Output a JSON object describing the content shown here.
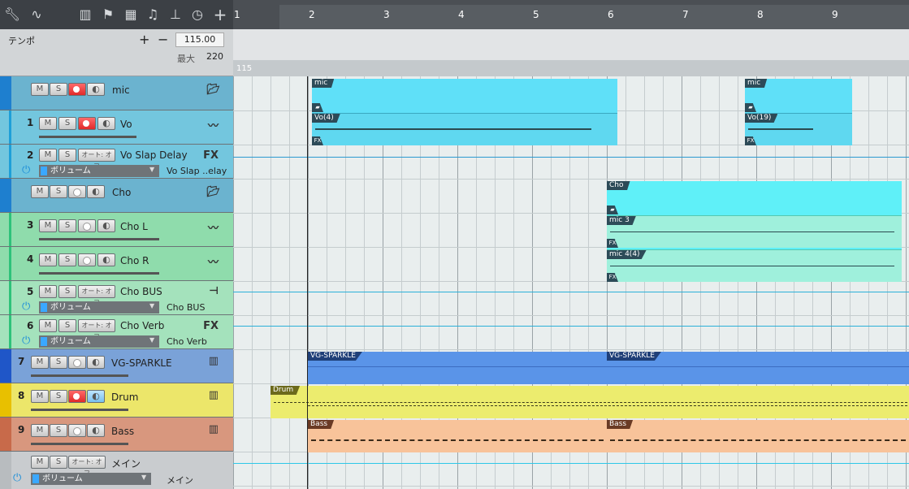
{
  "toolbar": {
    "icons": [
      "wrench-icon",
      "curve-icon",
      "mixer-icon",
      "flag-icon",
      "grid-icon",
      "note-icon",
      "split-icon",
      "clock-icon",
      "plus-icon"
    ]
  },
  "tempo": {
    "label": "テンポ",
    "value": "115.00",
    "max_label": "最大",
    "max_value": "220",
    "lane_value": "115"
  },
  "ruler": {
    "bars": [
      "1",
      "2",
      "3",
      "4",
      "5",
      "6",
      "7",
      "8",
      "9"
    ]
  },
  "buttons": {
    "mute": "M",
    "solo": "S",
    "auto_off": "オート: オフ"
  },
  "tracks": [
    {
      "id": "mic",
      "name": "mic",
      "type": "folder",
      "color": "#5aa8c8"
    },
    {
      "id": "vo",
      "num": "1",
      "name": "Vo",
      "type": "audio",
      "color": "#66c2dc"
    },
    {
      "id": "vo-slap",
      "num": "2",
      "name": "Vo Slap Delay",
      "type": "fx",
      "color": "#66c2dc",
      "param": "ボリューム",
      "param_value": "Vo Slap ..elay"
    },
    {
      "id": "cho",
      "name": "Cho",
      "type": "folder",
      "color": "#5aa8c8"
    },
    {
      "id": "chol",
      "num": "3",
      "name": "Cho L",
      "type": "audio",
      "color": "#86d9a8"
    },
    {
      "id": "chor",
      "num": "4",
      "name": "Cho R",
      "type": "audio",
      "color": "#86d9a8"
    },
    {
      "id": "chobus",
      "num": "5",
      "name": "Cho BUS",
      "type": "bus",
      "color": "#86d9a8",
      "param": "ボリューム",
      "param_value": "Cho BUS"
    },
    {
      "id": "choverb",
      "num": "6",
      "name": "Cho Verb",
      "type": "fx",
      "color": "#86d9a8",
      "param": "ボリューム",
      "param_value": "Cho Verb"
    },
    {
      "id": "vg",
      "num": "7",
      "name": "VG-SPARKLE",
      "type": "instrument",
      "color": "#6f98d4"
    },
    {
      "id": "drum",
      "num": "8",
      "name": "Drum",
      "type": "instrument",
      "color": "#e8df62"
    },
    {
      "id": "bass",
      "num": "9",
      "name": "Bass",
      "type": "instrument",
      "color": "#d4907a"
    },
    {
      "id": "main",
      "name": "メイン",
      "type": "main",
      "color": "#b8bcbf",
      "param": "ボリューム",
      "param_value": "メイン"
    }
  ],
  "clips": {
    "mic_a": "mic",
    "mic_b": "mic",
    "vo_a": "Vo(4)",
    "vo_b": "Vo(19)",
    "cho_folder": "Cho",
    "cho_l": "mic 3",
    "cho_r": "mic 4(4)",
    "vg_a": "VG-SPARKLE",
    "vg_b": "VG-SPARKLE",
    "drum": "Drum",
    "bass_a": "Bass",
    "bass_b": "Bass"
  },
  "colors": {
    "folder_clip": "#5fe0f8",
    "cho_clip": "#9ff0dc",
    "vg_clip": "#5a94e8",
    "drum_clip": "#ecec6e",
    "bass_clip": "#f8c39a",
    "record": "#e83a3a"
  }
}
